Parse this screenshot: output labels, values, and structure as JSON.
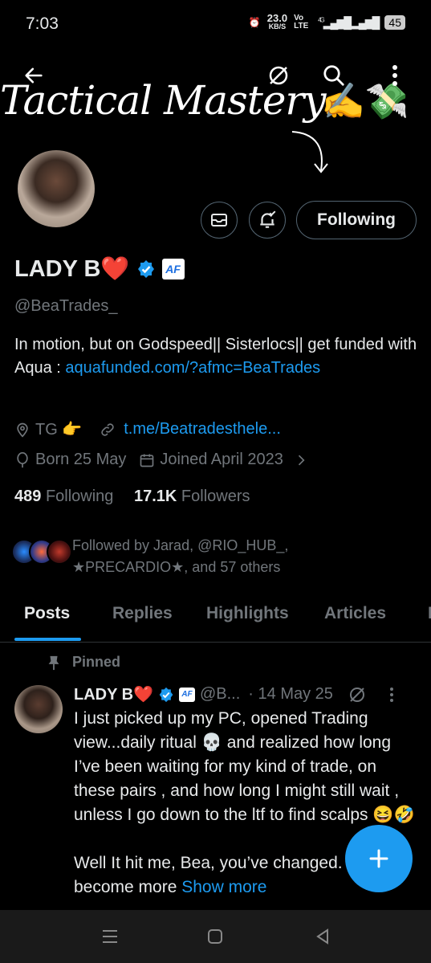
{
  "status_bar": {
    "time": "7:03",
    "network_speed": "23.0",
    "network_unit": "KB/S",
    "volte": "Vo LTE",
    "signal_label": "4G",
    "battery": "45"
  },
  "banner": {
    "text": "Tactical Mastery",
    "emoji": "✍️💸"
  },
  "header_icons": [
    "back-arrow-icon",
    "grok-icon",
    "search-icon",
    "more-vertical-icon"
  ],
  "profile": {
    "name": "LADY B❤️",
    "af_badge": "AF",
    "handle": "@BeaTrades_",
    "bio_text": "In motion, but on Godspeed|| Sisterlocs|| get funded with Aqua : ",
    "bio_link": "aquafunded.com/?afmc=BeaTrades",
    "location": "TG 👉",
    "website": "t.me/Beatradesthele...",
    "born": "Born 25 May",
    "joined": "Joined April 2023",
    "following_count": "489",
    "following_label": "Following",
    "followers_count": "17.1K",
    "followers_label": "Followers",
    "followed_by": "Followed by Jarad, @RIO_HUB_, ★PRECARDIO★, and 57 others",
    "follow_button": "Following"
  },
  "tabs": [
    "Posts",
    "Replies",
    "Highlights",
    "Articles",
    "M"
  ],
  "active_tab": "Posts",
  "post": {
    "pinned_label": "Pinned",
    "author": "LADY B❤️",
    "af_badge": "AF",
    "handle": "@B...",
    "date": "· 14 May 25",
    "text1": "I just picked up my  PC, opened Trading view...daily ritual 💀 and realized how long I’ve been waiting for my kind of trade, on these pairs , and how long I might still wait , unless I go down to the ltf to find scalps 😆🤣",
    "text2": "Well It hit me, Bea, you’ve  changed. I’ve become more ",
    "show_more": "Show more"
  },
  "colors": {
    "accent": "#1d9bf0",
    "background": "#000000",
    "muted": "#71767b"
  }
}
